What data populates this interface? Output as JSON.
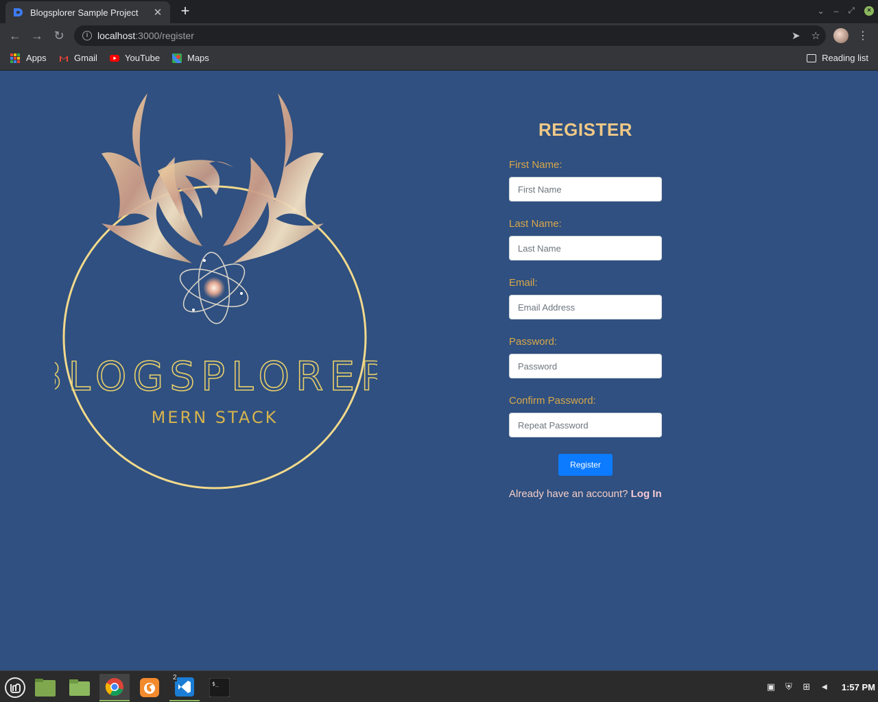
{
  "browser": {
    "tab_title": "Blogsplorer Sample Project",
    "tab_close": "✕",
    "new_tab": "+",
    "url_host": "localhost",
    "url_rest": ":3000/register",
    "bookmarks": [
      {
        "label": "Apps"
      },
      {
        "label": "Gmail"
      },
      {
        "label": "YouTube"
      },
      {
        "label": "Maps"
      }
    ],
    "reading_list": "Reading list"
  },
  "logo": {
    "brand": "BLOGSPLORER",
    "tagline": "MERN STACK"
  },
  "form": {
    "title": "REGISTER",
    "fields": [
      {
        "label": "First Name:",
        "placeholder": "First Name"
      },
      {
        "label": "Last Name:",
        "placeholder": "Last Name"
      },
      {
        "label": "Email:",
        "placeholder": "Email Address"
      },
      {
        "label": "Password:",
        "placeholder": "Password"
      },
      {
        "label": "Confirm Password:",
        "placeholder": "Repeat Password"
      }
    ],
    "submit": "Register",
    "login_prompt": "Already have an account?",
    "login_link": "Log In"
  },
  "taskbar": {
    "vscode_badge": "2",
    "clock": "1:57 PM"
  },
  "colors": {
    "page_bg": "#2f5080",
    "title": "#f0c987",
    "label": "#d9a74a",
    "button": "#0d7bff",
    "logo_gold": "#f2d98c"
  }
}
